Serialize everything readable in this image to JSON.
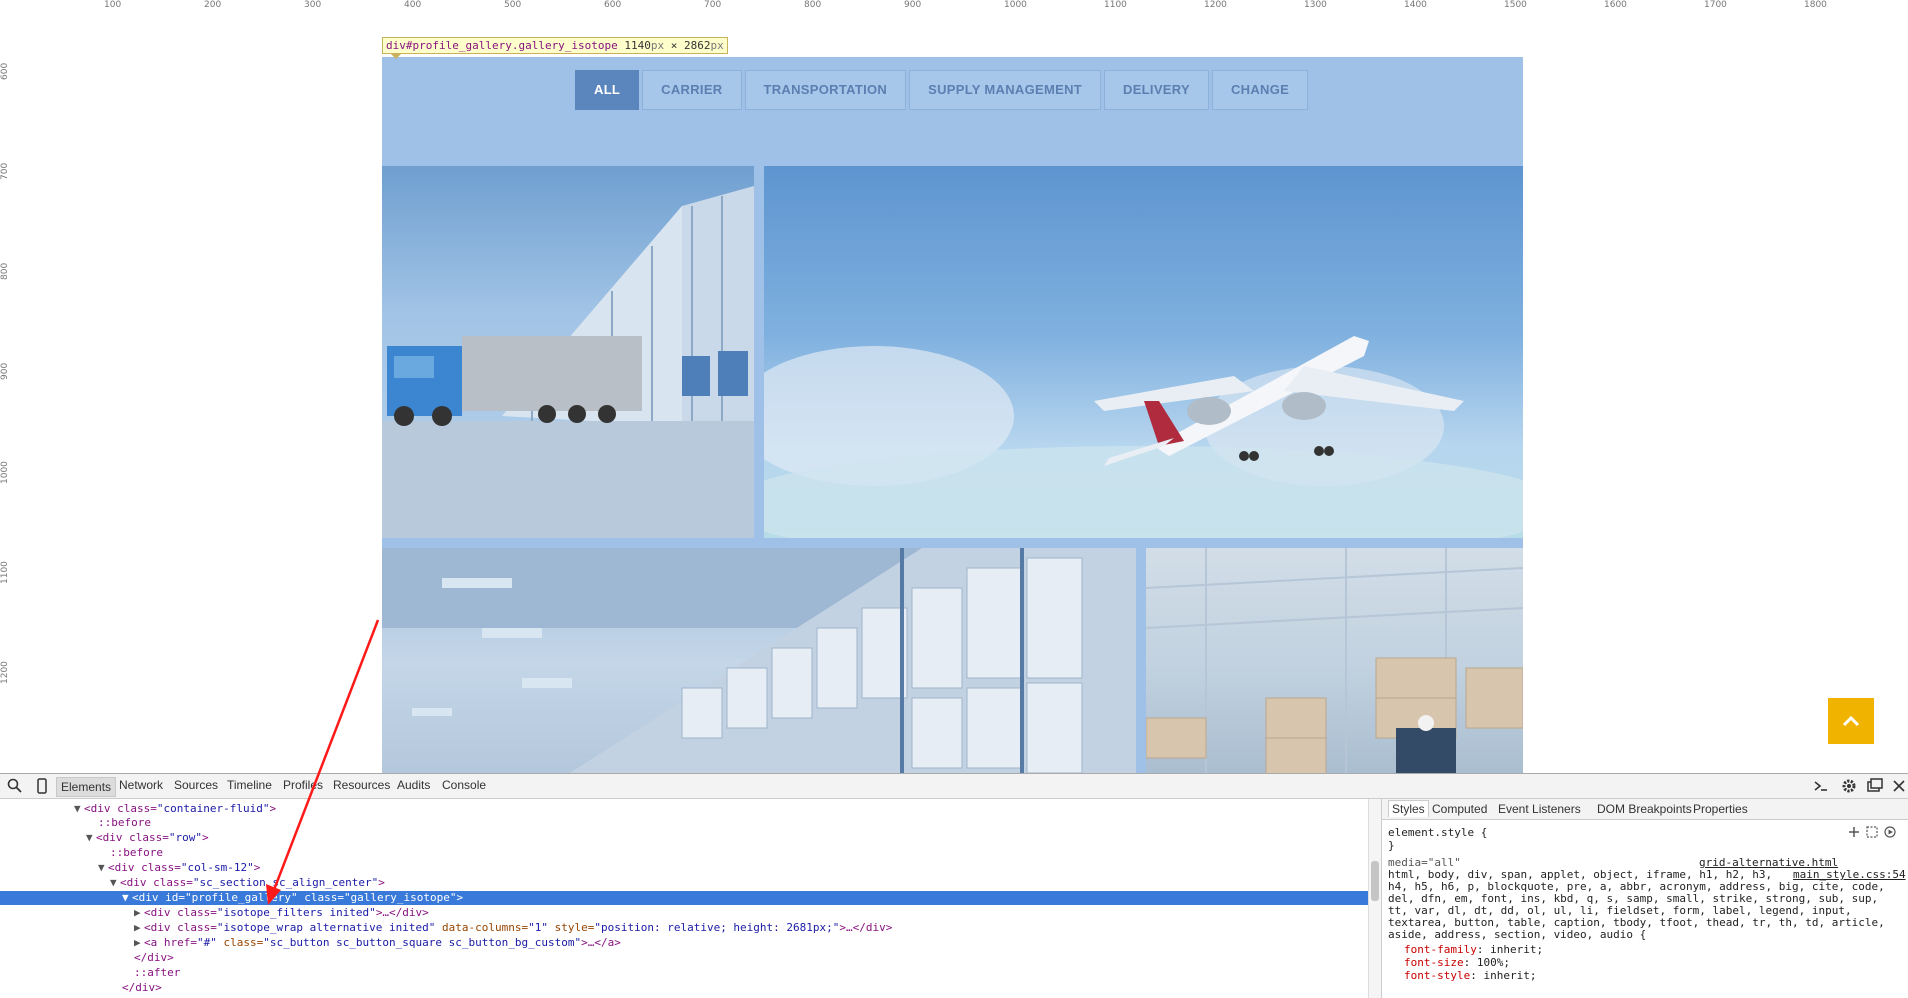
{
  "ruler": {
    "top_ticks": [
      "100",
      "200",
      "300",
      "400",
      "500",
      "600",
      "700",
      "800",
      "900",
      "1000",
      "1100",
      "1200",
      "1300",
      "1400",
      "1500",
      "1600",
      "1700",
      "1800"
    ],
    "left_ticks": [
      "600",
      "700",
      "800",
      "900",
      "1000",
      "1100",
      "1200"
    ]
  },
  "inspector_label": {
    "tag": "div#profile_gallery.gallery_isotope",
    "width": "1140",
    "height": "2862",
    "unit": "px",
    "times": "×"
  },
  "filters": [
    {
      "label": "ALL",
      "active": true
    },
    {
      "label": "CARRIER"
    },
    {
      "label": "TRANSPORTATION"
    },
    {
      "label": "SUPPLY MANAGEMENT"
    },
    {
      "label": "DELIVERY"
    },
    {
      "label": "CHANGE"
    }
  ],
  "gallery": {
    "images": [
      "truck-at-warehouse-image",
      "airplane-in-sky-image",
      "warehouse-shelves-image",
      "warehouse-forklift-image"
    ]
  },
  "back_to_top": {
    "icon": "chevron-up-icon",
    "color": "#f0b400"
  },
  "devtools": {
    "tabs": [
      "Elements",
      "Network",
      "Sources",
      "Timeline",
      "Profiles",
      "Resources",
      "Audits",
      "Console"
    ],
    "active_tab": "Elements",
    "dom": {
      "l1": {
        "open": "<div class=",
        "val": "\"container-fluid\"",
        "close": ">"
      },
      "l2": "::before",
      "l3": {
        "open": "<div class=",
        "val": "\"row\"",
        "close": ">"
      },
      "l4": "::before",
      "l5": {
        "open": "<div class=",
        "val": "\"col-sm-12\"",
        "close": ">"
      },
      "l6": {
        "open": "<div class=",
        "val": "\"sc_section sc_align_center\"",
        "close": ">"
      },
      "l7": {
        "open": "<div id=",
        "val": "\"profile_gallery\"",
        "mid": " class=",
        "val2": "\"gallery_isotope\"",
        "close": ">"
      },
      "l8": {
        "open": "<div class=",
        "val": "\"isotope_filters inited\"",
        "close": ">…</div>"
      },
      "l9": {
        "open": "<div class=",
        "val": "\"isotope_wrap alternative inited\"",
        "mid": " data-columns=",
        "val2": "\"1\"",
        "mid2": " style=",
        "val3": "\"position: relative; height: 2681px;\"",
        "close": ">…</div>"
      },
      "l10": {
        "open": "<a href=",
        "val": "\"#\"",
        "mid": " class=",
        "val2": "\"sc_button sc_button_square sc_button_bg_custom\"",
        "close": ">…</a>"
      },
      "l11": "</div>",
      "l12": "::after",
      "l13": "</div>"
    },
    "styles_tabs": [
      "Styles",
      "Computed",
      "Event Listeners",
      "DOM Breakpoints",
      "Properties"
    ],
    "styles": {
      "element_style": "element.style {",
      "close_brace": "}",
      "media": "media=\"all\"",
      "source1": "grid-alternative.html",
      "source2": "main_style.css:54",
      "selector_lines": [
        "html, body, div, span, applet, object, iframe, h1, h2, h3,",
        "h4, h5, h6, p, blockquote, pre, a, abbr, acronym, address, big, cite, code,",
        "del, dfn, em, font, ins, kbd, q, s, samp, small, strike, strong, sub, sup,",
        "tt, var, dl, dt, dd, ol, ul, li, fieldset, form, label, legend, input,",
        "textarea, button, table, caption, tbody, tfoot, thead, tr, th, td, article,",
        "aside, address, section, video, audio {"
      ],
      "props": [
        {
          "name": "font-family",
          "value": "inherit;"
        },
        {
          "name": "font-size",
          "value": "100%;"
        },
        {
          "name": "font-style",
          "value": "inherit;"
        }
      ]
    }
  },
  "annotation_arrow_color": "#ff0000"
}
